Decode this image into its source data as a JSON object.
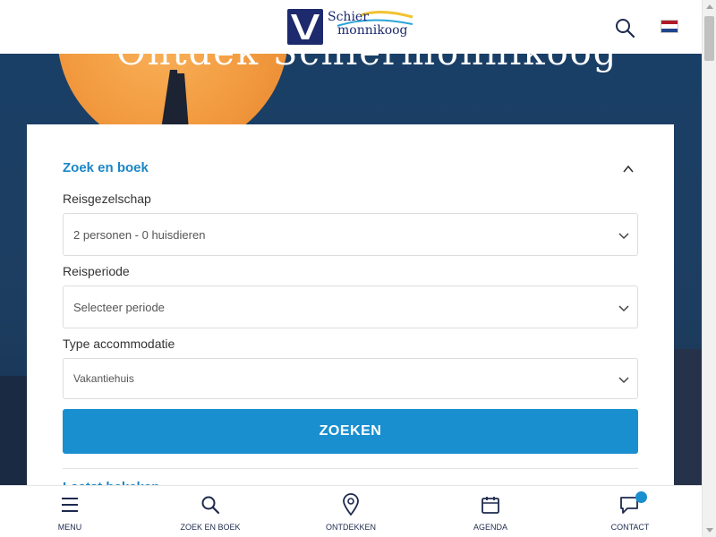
{
  "header": {
    "logo_line1": "Schier",
    "logo_line2": "monnikoog",
    "search_icon": "search-icon",
    "language_flag": "netherlands-flag-icon"
  },
  "hero": {
    "title_fragment": "Ontdek Schiermonnikoog"
  },
  "search_form": {
    "title": "Zoek en boek",
    "fields": [
      {
        "label": "Reisgezelschap",
        "value": "2 personen - 0 huisdieren"
      },
      {
        "label": "Reisperiode",
        "value": "Selecteer periode"
      },
      {
        "label": "Type accommodatie",
        "value": "Vakantiehuis"
      }
    ],
    "submit_label": "ZOEKEN",
    "recently_viewed_title": "Laatst bekeken"
  },
  "bottom_nav": {
    "items": [
      {
        "label": "MENU",
        "icon": "hamburger-icon"
      },
      {
        "label": "ZOEK EN BOEK",
        "icon": "search-icon"
      },
      {
        "label": "ONTDEKKEN",
        "icon": "map-pin-icon"
      },
      {
        "label": "AGENDA",
        "icon": "calendar-icon"
      },
      {
        "label": "CONTACT",
        "icon": "chat-icon"
      }
    ]
  },
  "colors": {
    "brand_navy": "#1d2a6e",
    "accent_blue": "#1a8fd0",
    "heading_blue": "#1a86c7"
  }
}
